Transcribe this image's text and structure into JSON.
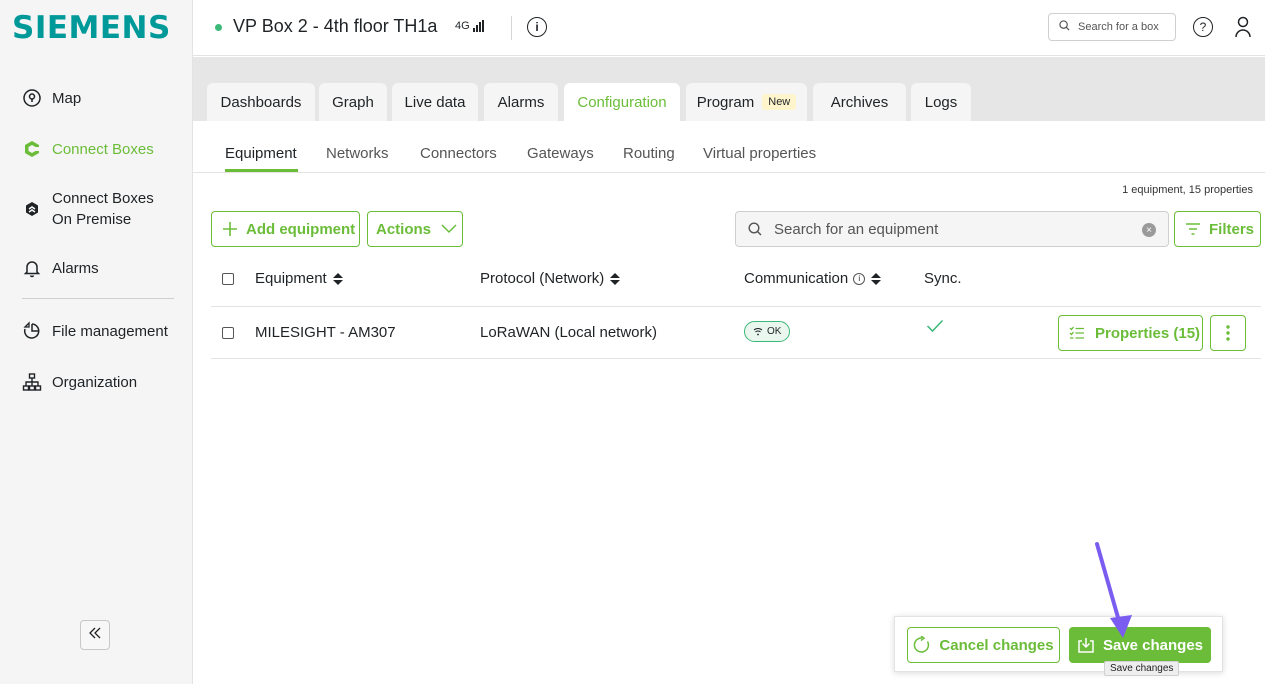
{
  "brand": {
    "logo": "SIEMENS",
    "accent": "#6bbd39",
    "logo_color": "#009999",
    "status_color": "#3cb878"
  },
  "sidebar": {
    "items": [
      {
        "label": "Map",
        "icon": "map-pin-icon"
      },
      {
        "label": "Connect Boxes",
        "icon": "connect-box-icon",
        "active": true
      },
      {
        "label_line1": "Connect Boxes",
        "label_line2": "On Premise",
        "icon": "on-premise-icon"
      },
      {
        "label": "Alarms",
        "icon": "bell-icon"
      },
      {
        "label": "File management",
        "icon": "file-management-icon"
      },
      {
        "label": "Organization",
        "icon": "organization-icon"
      }
    ],
    "collapse_icon": "double-chevron-left-icon"
  },
  "header": {
    "box_title": "VP Box 2 - 4th floor TH1a",
    "network": "4G",
    "search_placeholder": "Search for a box"
  },
  "tabs": [
    {
      "label": "Dashboards"
    },
    {
      "label": "Graph"
    },
    {
      "label": "Live data"
    },
    {
      "label": "Alarms"
    },
    {
      "label": "Configuration",
      "active": true
    },
    {
      "label": "Program",
      "badge": "New"
    },
    {
      "label": "Archives"
    },
    {
      "label": "Logs"
    }
  ],
  "subtabs": [
    {
      "label": "Equipment",
      "active": true
    },
    {
      "label": "Networks"
    },
    {
      "label": "Connectors"
    },
    {
      "label": "Gateways"
    },
    {
      "label": "Routing"
    },
    {
      "label": "Virtual properties"
    }
  ],
  "summary": "1 equipment, 15 properties",
  "toolbar": {
    "add_label": "Add equipment",
    "actions_label": "Actions",
    "search_placeholder": "Search for an equipment",
    "filters_label": "Filters"
  },
  "table": {
    "columns": {
      "equipment": "Equipment",
      "protocol": "Protocol (Network)",
      "communication": "Communication",
      "sync": "Sync."
    },
    "rows": [
      {
        "equipment": "MILESIGHT - AM307",
        "protocol": "LoRaWAN (Local network)",
        "communication": "OK",
        "synced": true,
        "properties_label": "Properties (15)"
      }
    ]
  },
  "savebar": {
    "cancel_label": "Cancel changes",
    "save_label": "Save changes",
    "tooltip": "Save changes"
  }
}
